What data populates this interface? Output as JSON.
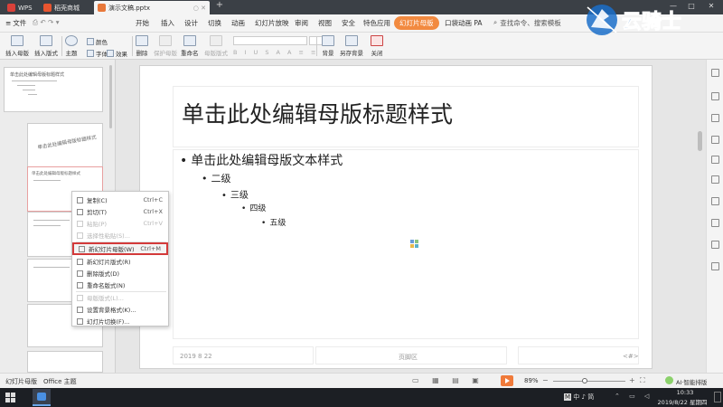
{
  "titlebar": {
    "tabs": [
      {
        "label": "WPS",
        "color": "#d9413a"
      },
      {
        "label": "稻壳商城",
        "color": "#e8552f"
      },
      {
        "label": "演示文稿.pptx",
        "color": "#e8783a"
      }
    ],
    "add_tab": "+",
    "win_min": "—",
    "win_max": "□",
    "win_close": "✕"
  },
  "menubar": {
    "file": "文件",
    "items": [
      "开始",
      "插入",
      "设计",
      "切换",
      "动画",
      "幻灯片放映",
      "审阅",
      "视图",
      "安全",
      "特色应用"
    ],
    "active_tab": "幻灯片母版",
    "extra": "口袋动画 PA",
    "search": "查找命令、搜索模板"
  },
  "toolbar": {
    "insert_master": "插入母版",
    "insert_layout": "插入版式",
    "theme": "主题",
    "color": "颜色",
    "font": "字体",
    "effect": "效果",
    "delete": "删除",
    "preserve": "保护母版",
    "rename": "重命名",
    "master_layout": "母版版式",
    "background": "背景",
    "save_bg": "另存背景",
    "close": "关闭"
  },
  "slide": {
    "title": "单击此处编辑母版标题样式",
    "level1": "单击此处编辑母版文本样式",
    "level2": "二级",
    "level3": "三级",
    "level4": "四级",
    "level5": "五级",
    "footer_date": "2019  8  22",
    "footer_text": "页脚区",
    "footer_num": "<#>"
  },
  "thumbs": {
    "t1_title": "单击此处编辑母版标题样式",
    "t2_title": "单击此处编辑母版标题样式",
    "t3_title": "单击此处编辑母版标题样式"
  },
  "context_menu": {
    "copy": "复制(C)",
    "copy_sc": "Ctrl+C",
    "cut": "剪切(T)",
    "cut_sc": "Ctrl+X",
    "paste": "粘贴(P)",
    "paste_sc": "Ctrl+V",
    "paste_special": "选择性粘贴(S)...",
    "new_master": "新幻灯片母版(W)",
    "new_master_sc": "Ctrl+M",
    "new_layout": "新幻灯片版式(R)",
    "delete_layout": "删除版式(D)",
    "rename_layout": "重命名版式(N)",
    "master_layout": "母版版式(L)...",
    "bg_format": "设置背景格式(K)...",
    "transition": "幻灯片切换(F)..."
  },
  "statusbar": {
    "view": "幻灯片母版",
    "theme": "Office 主题",
    "zoom": "89%",
    "ai": "AI·智能排版"
  },
  "taskbar": {
    "tray": "中 ♪ 简",
    "time": "10:33",
    "date": "2019/8/22 星期四"
  },
  "watermark": {
    "text": "云骑士"
  }
}
